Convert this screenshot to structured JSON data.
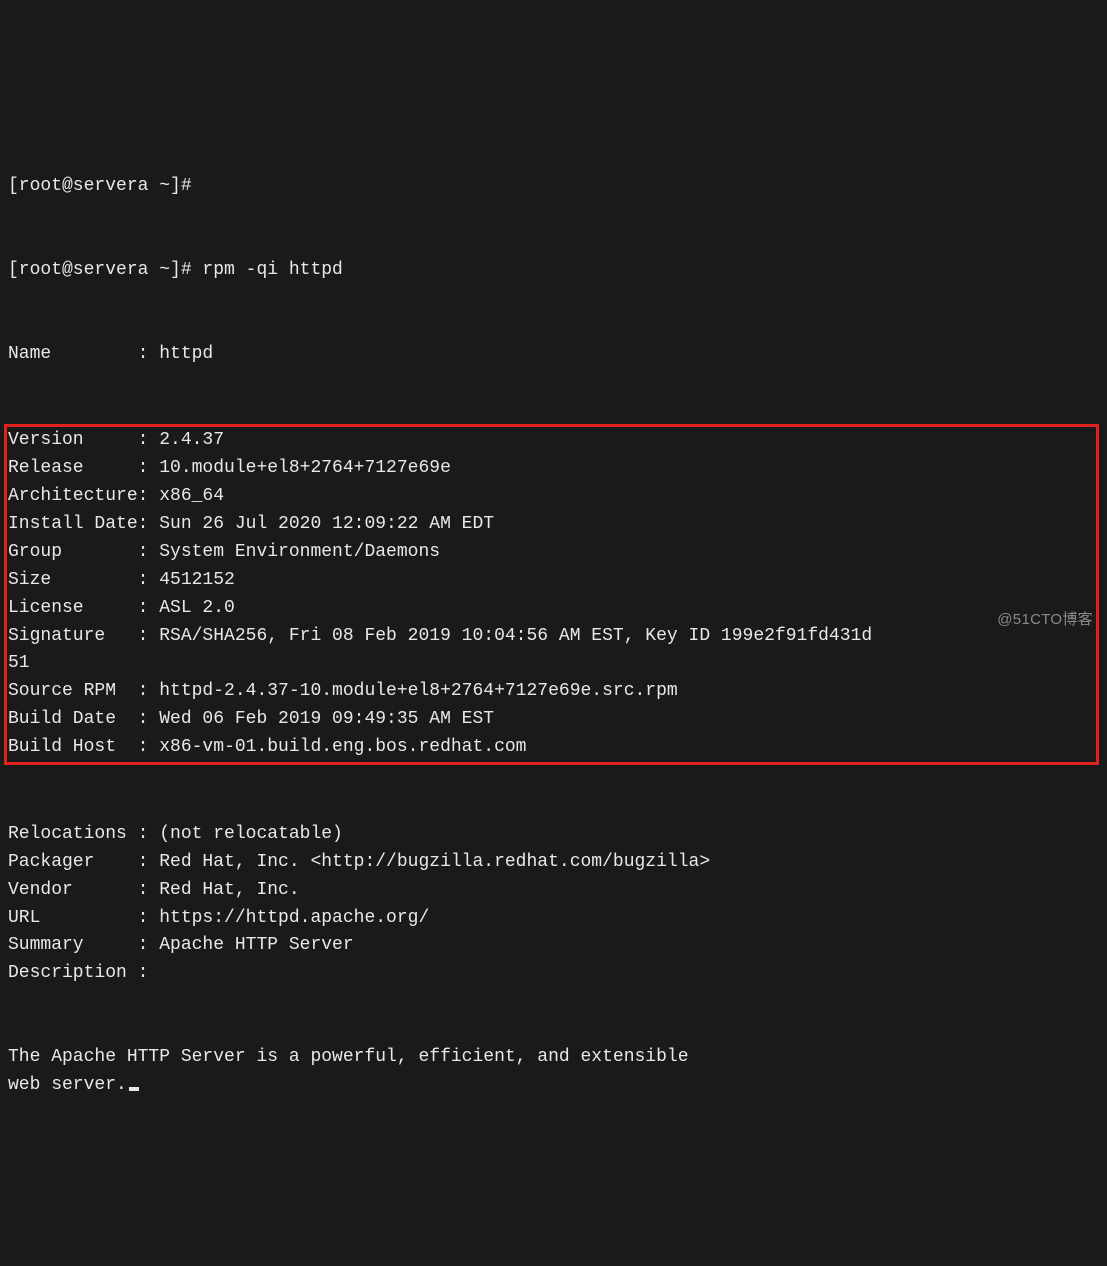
{
  "prompts": [
    "[root@servera ~]#",
    "[root@servera ~]# rpm -qi httpd"
  ],
  "top_fields": [
    {
      "label": "Name        ",
      "value": "httpd"
    }
  ],
  "boxed_fields": [
    {
      "label": "Version     ",
      "value": "2.4.37"
    },
    {
      "label": "Release     ",
      "value": "10.module+el8+2764+7127e69e"
    },
    {
      "label": "Architecture",
      "value": "x86_64"
    },
    {
      "label": "Install Date",
      "value": "Sun 26 Jul 2020 12:09:22 AM EDT"
    },
    {
      "label": "Group       ",
      "value": "System Environment/Daemons"
    },
    {
      "label": "Size        ",
      "value": "4512152"
    },
    {
      "label": "License     ",
      "value": "ASL 2.0"
    },
    {
      "label": "Signature   ",
      "value": "RSA/SHA256, Fri 08 Feb 2019 10:04:56 AM EST, Key ID 199e2f91fd431d\n51"
    },
    {
      "label": "Source RPM  ",
      "value": "httpd-2.4.37-10.module+el8+2764+7127e69e.src.rpm"
    },
    {
      "label": "Build Date  ",
      "value": "Wed 06 Feb 2019 09:49:35 AM EST"
    },
    {
      "label": "Build Host  ",
      "value": "x86-vm-01.build.eng.bos.redhat.com"
    }
  ],
  "bottom_fields": [
    {
      "label": "Relocations ",
      "value": "(not relocatable)"
    },
    {
      "label": "Packager    ",
      "value": "Red Hat, Inc. <http://bugzilla.redhat.com/bugzilla>"
    },
    {
      "label": "Vendor      ",
      "value": "Red Hat, Inc."
    },
    {
      "label": "URL         ",
      "value": "https://httpd.apache.org/"
    },
    {
      "label": "Summary     ",
      "value": "Apache HTTP Server"
    },
    {
      "label": "Description ",
      "value": ""
    }
  ],
  "description_body": "The Apache HTTP Server is a powerful, efficient, and extensible\nweb server.",
  "watermark": "@51CTO博客"
}
